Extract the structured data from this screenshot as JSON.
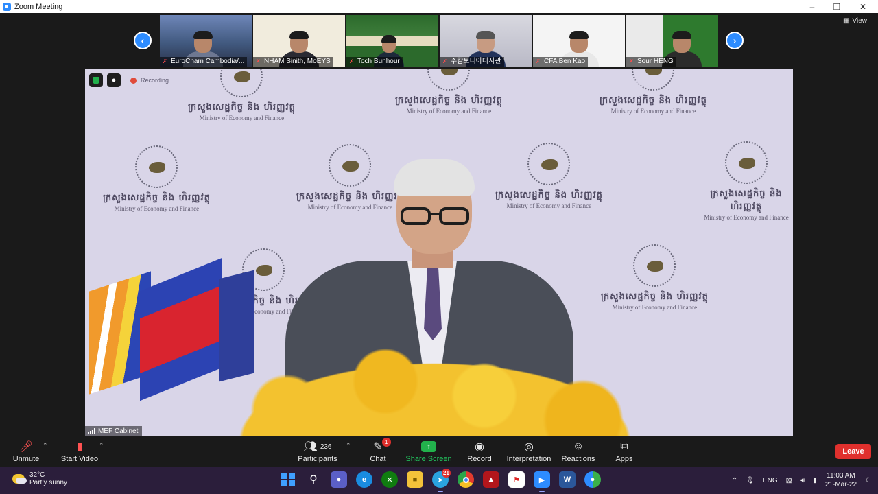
{
  "window": {
    "title": "Zoom Meeting"
  },
  "view_button": {
    "label": "View"
  },
  "thumbnails": [
    {
      "name": "EuroCham Cambodia/...",
      "bg": "#3a4f72"
    },
    {
      "name": "NHAM Sinith, MoEYS",
      "bg": "#f3efe2"
    },
    {
      "name": "Toch Bunhour",
      "bg": "#2f6b2f"
    },
    {
      "name": "주캄보디아대사관",
      "bg": "#c9c9d3"
    },
    {
      "name": "CFA Ben Kao",
      "bg": "#f2f2f2"
    },
    {
      "name": "Sour HENG",
      "bg": "#2f7a2f"
    }
  ],
  "main_video": {
    "recording_label": "Recording",
    "speaker_name": "MEF Cabinet",
    "backdrop_kh": "ក្រសួងសេដ្ឋកិច្ច និង ហិរញ្ញវត្ថុ",
    "backdrop_en": "Ministry of Economy and Finance"
  },
  "toolbar": {
    "unmute": "Unmute",
    "start_video": "Start Video",
    "participants": "Participants",
    "participants_count": "236",
    "chat": "Chat",
    "chat_badge": "1",
    "share_screen": "Share Screen",
    "record": "Record",
    "interpretation": "Interpretation",
    "reactions": "Reactions",
    "apps": "Apps",
    "leave": "Leave"
  },
  "taskbar": {
    "temperature": "32°C",
    "weather": "Partly sunny",
    "telegram_badge": "21",
    "language": "ENG",
    "time": "11:03 AM",
    "date": "21-Mar-22"
  },
  "colors": {
    "accent": "#2d8cff",
    "leave": "#e0302d",
    "share": "#22b14c"
  }
}
